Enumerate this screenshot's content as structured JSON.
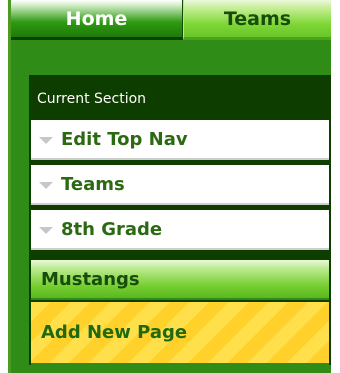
{
  "topnav": {
    "tabs": [
      {
        "label": "Home"
      },
      {
        "label": "Teams"
      }
    ]
  },
  "section": {
    "header": "Current Section",
    "items": [
      {
        "label": "Edit Top Nav"
      },
      {
        "label": "Teams"
      },
      {
        "label": "8th Grade"
      }
    ],
    "active_item": "Mustangs",
    "add_new": "Add New Page"
  },
  "colors": {
    "frame_green": "#2f8c16",
    "dark_green": "#0e3d00",
    "text_green": "#2b6a12",
    "highlight_green": "#74cd2e",
    "add_yellow": "#ffd12a"
  }
}
